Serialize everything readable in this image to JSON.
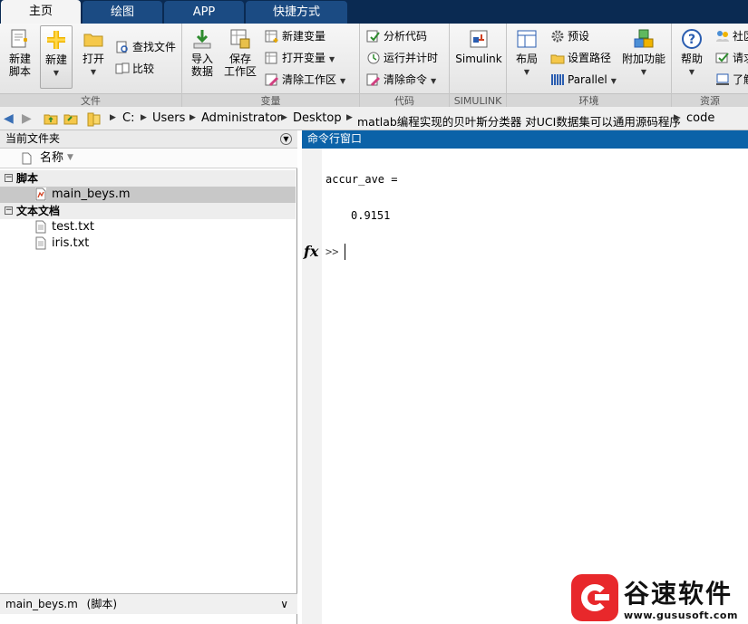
{
  "tabs": [
    {
      "label": "主页"
    },
    {
      "label": "绘图"
    },
    {
      "label": "APP"
    },
    {
      "label": "快捷方式"
    }
  ],
  "ribbon": {
    "sections": [
      {
        "label": "文件"
      },
      {
        "label": "变量"
      },
      {
        "label": "代码"
      },
      {
        "label": "SIMULINK"
      },
      {
        "label": "环境"
      },
      {
        "label": "资源"
      }
    ],
    "new_script_line1": "新建",
    "new_script_line2": "脚本",
    "new_label": "新建",
    "open_label": "打开",
    "find_files": "查找文件",
    "compare": "比较",
    "import_line1": "导入",
    "import_line2": "数据",
    "save_ws_line1": "保存",
    "save_ws_line2": "工作区",
    "new_variable": "新建变量",
    "open_variable": "打开变量",
    "clear_workspace": "清除工作区",
    "analyze_code": "分析代码",
    "run_and_time": "运行并计时",
    "clear_commands": "清除命令",
    "simulink": "Simulink",
    "layout": "布局",
    "preferences": "预设",
    "set_path": "设置路径",
    "parallel": "Parallel",
    "addons": "附加功能",
    "help": "帮助",
    "community": "社区",
    "request_support": "请求",
    "learn": "了解"
  },
  "address": {
    "crumbs": [
      "C:",
      "Users",
      "Administrator",
      "Desktop",
      "matlab编程实现的贝叶斯分类器 对UCI数据集可以通用源码程序",
      "code"
    ]
  },
  "left_panel": {
    "title": "当前文件夹",
    "column_name": "名称",
    "groups": [
      {
        "label": "脚本",
        "files": [
          "main_beys.m"
        ]
      },
      {
        "label": "文本文档",
        "files": [
          "test.txt",
          "iris.txt"
        ]
      }
    ],
    "details_file": "main_beys.m",
    "details_type": "(脚本)"
  },
  "command_window": {
    "title": "命令行窗口",
    "lines": [
      "accur_ave =",
      "0.9151"
    ],
    "prompt": ">>",
    "fx": "fx"
  },
  "watermark": {
    "name": "谷速软件",
    "url": "www.gususoft.com"
  }
}
